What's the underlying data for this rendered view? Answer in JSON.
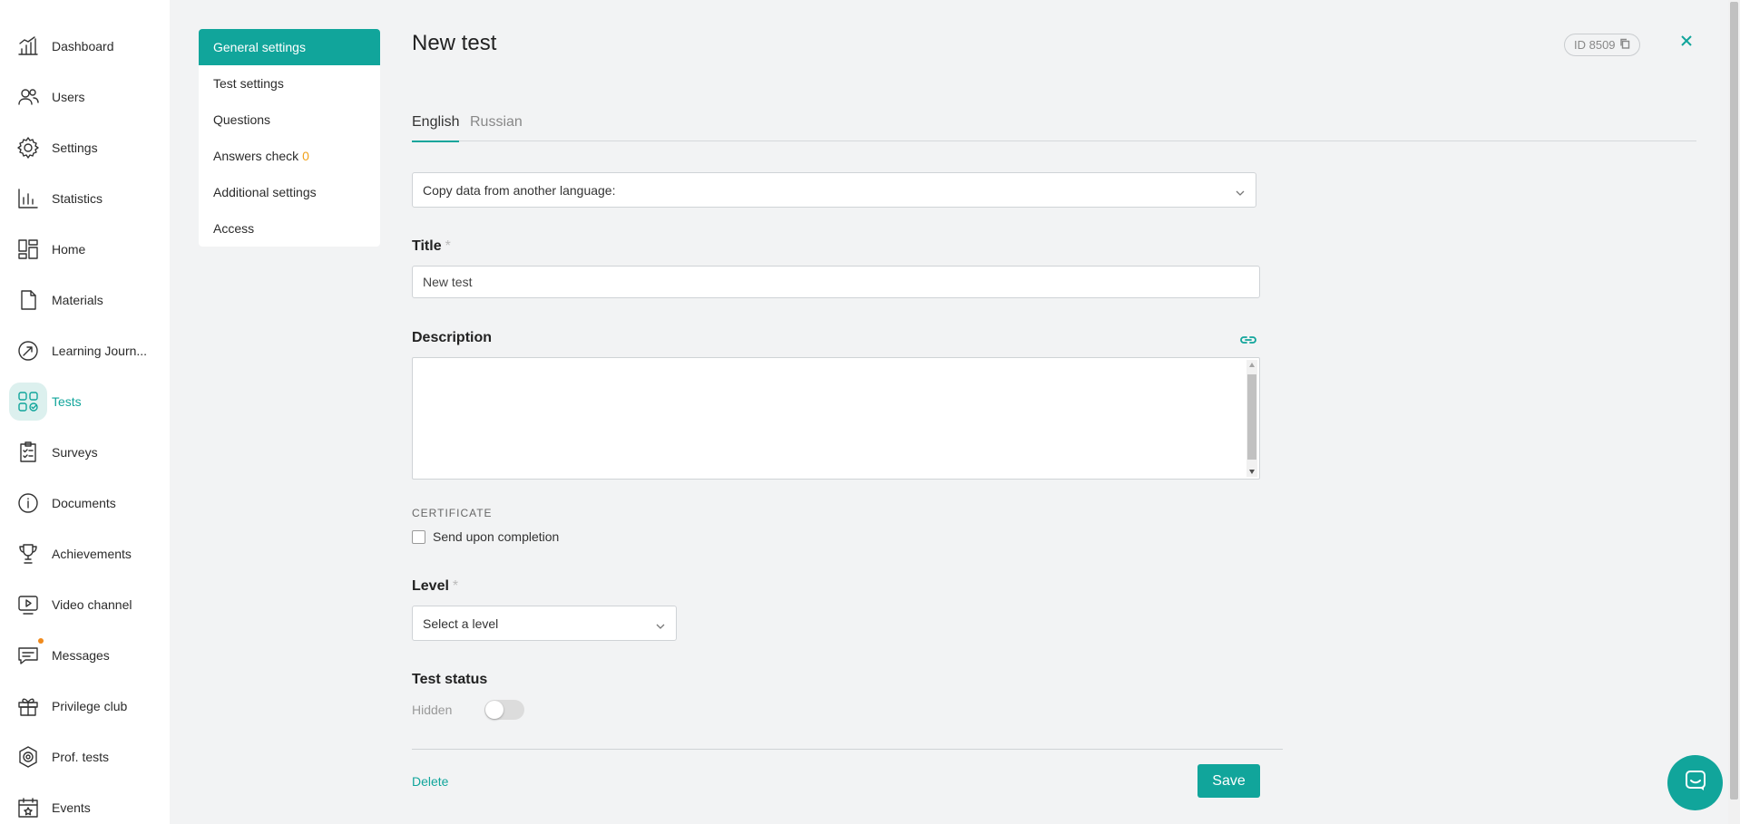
{
  "sidebar": {
    "items": [
      {
        "label": "Dashboard",
        "icon": "dashboard-icon"
      },
      {
        "label": "Users",
        "icon": "users-icon"
      },
      {
        "label": "Settings",
        "icon": "gear-icon"
      },
      {
        "label": "Statistics",
        "icon": "bar-chart-icon"
      },
      {
        "label": "Home",
        "icon": "home-grid-icon"
      },
      {
        "label": "Materials",
        "icon": "document-icon"
      },
      {
        "label": "Learning Journ...",
        "icon": "trajectory-icon"
      },
      {
        "label": "Tests",
        "icon": "tests-icon",
        "active": true
      },
      {
        "label": "Surveys",
        "icon": "survey-checklist-icon"
      },
      {
        "label": "Documents",
        "icon": "info-circle-icon"
      },
      {
        "label": "Achievements",
        "icon": "trophy-icon"
      },
      {
        "label": "Video channel",
        "icon": "video-icon"
      },
      {
        "label": "Messages",
        "icon": "message-icon",
        "notification_dot": true
      },
      {
        "label": "Privilege club",
        "icon": "gift-icon"
      },
      {
        "label": "Prof. tests",
        "icon": "hexagon-icon"
      },
      {
        "label": "Events",
        "icon": "calendar-icon"
      }
    ]
  },
  "section_menu": {
    "items": [
      {
        "label": "General settings",
        "active": true
      },
      {
        "label": "Test settings"
      },
      {
        "label": "Questions"
      },
      {
        "label": "Answers check",
        "count": "0"
      },
      {
        "label": "Additional settings"
      },
      {
        "label": "Access"
      }
    ]
  },
  "header": {
    "title": "New test",
    "id_badge": "ID 8509"
  },
  "tabs": [
    {
      "label": "English",
      "active": true
    },
    {
      "label": "Russian"
    }
  ],
  "form": {
    "copy_select_label": "Copy data from another language:",
    "title_label": "Title",
    "title_value": "New test",
    "required_mark": "*",
    "description_label": "Description",
    "description_value": "",
    "certificate_heading": "CERTIFICATE",
    "certificate_checkbox_label": "Send upon completion",
    "level_label": "Level",
    "level_placeholder": "Select a level",
    "status_label": "Test status",
    "status_value": "Hidden",
    "delete_label": "Delete",
    "save_label": "Save"
  },
  "colors": {
    "accent": "#11a59b",
    "count": "#f0a21c",
    "notification": "#f08a1c",
    "page_bg": "#f2f3f4"
  }
}
